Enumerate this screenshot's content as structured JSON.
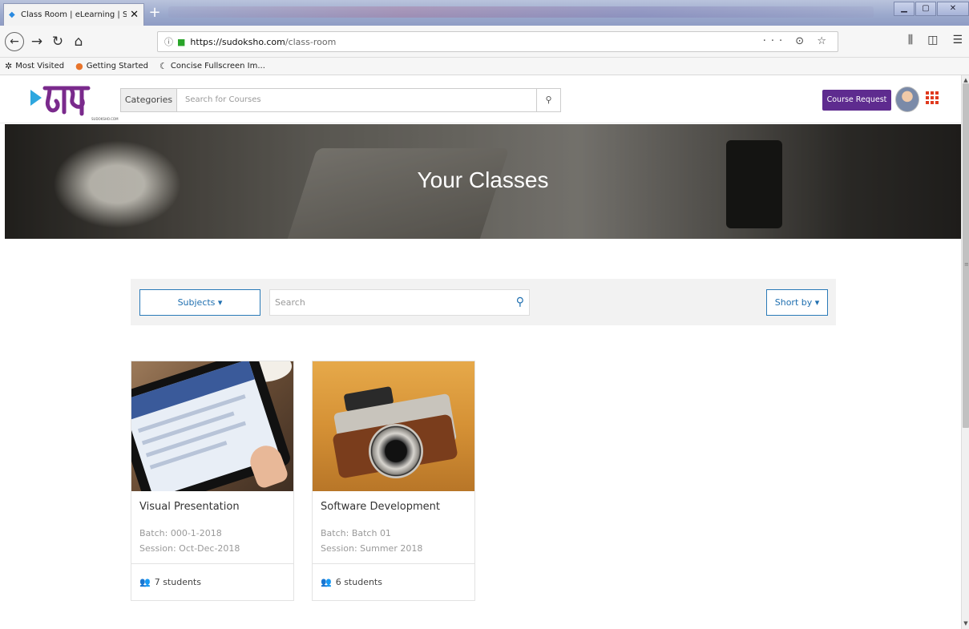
{
  "browser": {
    "tab_title": "Class Room | eLearning | Sudol",
    "tab_close": "✕",
    "new_tab": "+",
    "url_host": "https://sudoksho.com",
    "url_path": "/class-room",
    "url_actions": "··· ⊙ ☆",
    "bookmarks": [
      {
        "icon": "gear-icon",
        "label": "Most Visited"
      },
      {
        "icon": "firefox-icon",
        "label": "Getting Started"
      },
      {
        "icon": "fullscreen-icon",
        "label": "Concise Fullscreen Im..."
      }
    ]
  },
  "site": {
    "logo_sub": "SUDOKSHO.COM",
    "categories_label": "Categories",
    "header_search_placeholder": "Search for Courses",
    "course_request_label": "Course Request",
    "brand_color": "#5e2b8f",
    "apps_color": "#e03a1e"
  },
  "hero": {
    "title": "Your Classes"
  },
  "filters": {
    "subjects_label": "Subjects ▾",
    "search_placeholder": "Search",
    "sort_label": "Short by ▾",
    "accent_color": "#1f6fb0"
  },
  "classes": [
    {
      "title": "Visual Presentation",
      "batch": "Batch: 000-1-2018",
      "session": "Session: Oct-Dec-2018",
      "students": "7 students"
    },
    {
      "title": "Software Development",
      "batch": "Batch: Batch 01",
      "session": "Session: Summer 2018",
      "students": "6 students"
    }
  ]
}
